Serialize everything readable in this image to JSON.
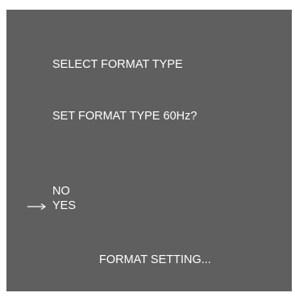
{
  "osd": {
    "title": "SELECT FORMAT TYPE",
    "question": "SET FORMAT TYPE 60Hz?",
    "options": [
      {
        "label": "NO",
        "selected": false
      },
      {
        "label": "YES",
        "selected": true
      }
    ],
    "selection_indicator_icon": "right-arrow-icon",
    "status": "FORMAT SETTING...",
    "colors": {
      "background": "#5f5f5f",
      "text": "#ffffff"
    }
  }
}
